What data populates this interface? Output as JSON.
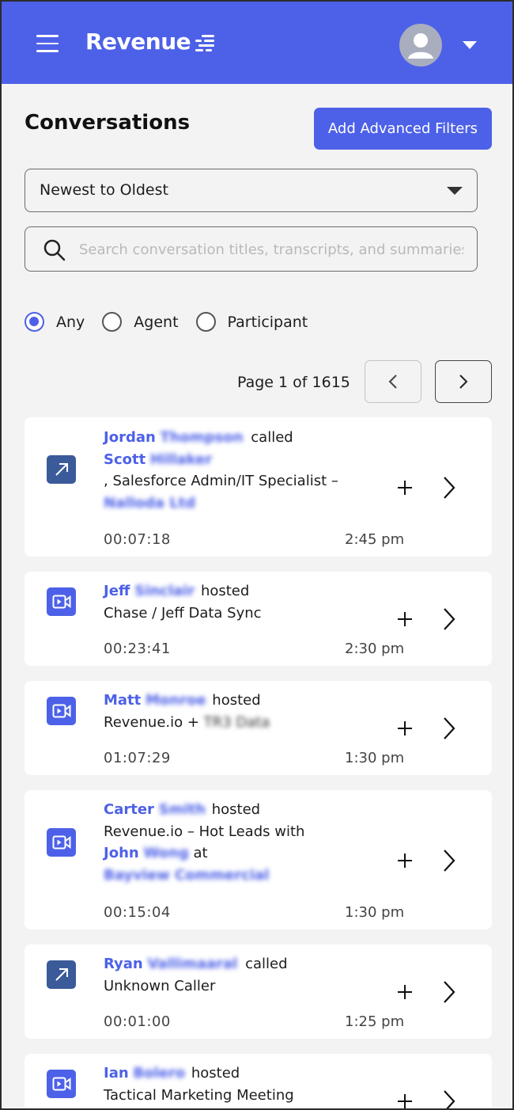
{
  "header": {
    "logo_text": "Revenue",
    "brand_color": "#4d61e8",
    "menu_icon": "hamburger-icon",
    "avatar_icon": "user-icon",
    "account_menu_icon": "caret-down-icon"
  },
  "page": {
    "title": "Conversations",
    "filters_button": "Add Advanced Filters"
  },
  "sort": {
    "selected": "Newest to Oldest"
  },
  "search": {
    "placeholder": "Search conversation titles, transcripts, and summaries"
  },
  "role_filter": {
    "options": [
      {
        "label": "Any",
        "selected": true
      },
      {
        "label": "Agent",
        "selected": false
      },
      {
        "label": "Participant",
        "selected": false
      }
    ]
  },
  "pagination": {
    "text": "Page 1 of 1615",
    "prev_icon": "chevron-left-icon",
    "next_icon": "chevron-right-icon"
  },
  "conversations": [
    {
      "type": "call",
      "icon": "outgoing-call-icon",
      "host_first": "Jordan",
      "host_rest": "Thompson",
      "verb": "called",
      "target_first": "Scott",
      "target_rest": "Hillaker",
      "role_text": ", Salesforce Admin/IT Specialist –",
      "company": "Nalloda Ltd",
      "duration": "00:07:18",
      "time": "2:45 pm"
    },
    {
      "type": "video",
      "icon": "video-meeting-icon",
      "host_first": "Jeff",
      "host_rest": "Sinclair",
      "verb": "hosted",
      "title": "Chase / Jeff Data Sync",
      "duration": "00:23:41",
      "time": "2:30 pm"
    },
    {
      "type": "video",
      "icon": "video-meeting-icon",
      "host_first": "Matt",
      "host_rest": "Monroe",
      "verb": "hosted",
      "title": "Revenue.io +",
      "title_tail": "TR3 Data",
      "duration": "01:07:29",
      "time": "1:30 pm"
    },
    {
      "type": "video",
      "icon": "video-meeting-icon",
      "host_first": "Carter",
      "host_rest": "Smith",
      "verb": "hosted",
      "title": "Revenue.io – Hot Leads with",
      "with_first": "John",
      "with_rest": "Wong",
      "with_suffix": "at",
      "company": "Bayview Commercial",
      "duration": "00:15:04",
      "time": "1:30 pm"
    },
    {
      "type": "call",
      "icon": "outgoing-call-icon",
      "host_first": "Ryan",
      "host_rest": "Vallimaaral",
      "verb": "called",
      "title": "Unknown Caller",
      "duration": "00:01:00",
      "time": "1:25 pm"
    },
    {
      "type": "video",
      "icon": "video-meeting-icon",
      "host_first": "Ian",
      "host_rest": "Bolero",
      "verb": "hosted",
      "title": "Tactical Marketing Meeting",
      "duration": "",
      "time": ""
    }
  ],
  "card_actions": {
    "add_icon": "plus-icon",
    "open_icon": "chevron-right-icon"
  }
}
